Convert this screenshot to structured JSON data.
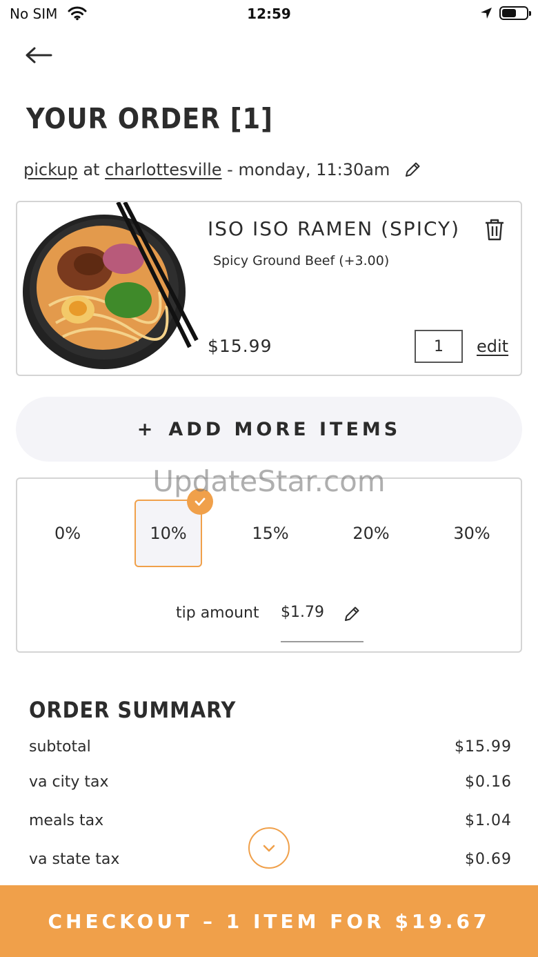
{
  "status_bar": {
    "carrier": "No SIM",
    "time": "12:59"
  },
  "header": {
    "title": "YOUR ORDER [1]"
  },
  "order_info": {
    "mode": "pickup",
    "at": "at",
    "location": "charlottesville",
    "time_text": "- monday, 11:30am"
  },
  "item": {
    "name": "ISO ISO RAMEN (SPICY)",
    "modifier": "Spicy Ground Beef (+3.00)",
    "price": "$15.99",
    "quantity": "1",
    "edit_label": "edit"
  },
  "add_more": {
    "plus": "+",
    "label": "ADD MORE ITEMS"
  },
  "watermark": "UpdateStar.com",
  "tip": {
    "options": [
      "0%",
      "10%",
      "15%",
      "20%",
      "30%"
    ],
    "selected": "10%",
    "amount_label": "tip amount",
    "amount_value": "$1.79"
  },
  "summary": {
    "title": "ORDER SUMMARY",
    "rows": [
      {
        "label": "subtotal",
        "amount": "$15.99"
      },
      {
        "label": "va city tax",
        "amount": "$0.16"
      },
      {
        "label": "meals tax",
        "amount": "$1.04"
      },
      {
        "label": "va state tax",
        "amount": "$0.69"
      }
    ]
  },
  "checkout": {
    "label": "CHECKOUT – 1 ITEM FOR $19.67"
  },
  "colors": {
    "accent": "#f0a04a",
    "text": "#2b2b2b",
    "border": "#d4d4d4",
    "button_bg": "#f4f4f8"
  },
  "icons": {
    "back": "arrow-left-icon",
    "pickup_edit": "pencil-icon",
    "delete": "trash-icon",
    "tip_edit": "pencil-icon",
    "tip_check": "check-icon",
    "scroll_down": "chevron-down-icon"
  }
}
